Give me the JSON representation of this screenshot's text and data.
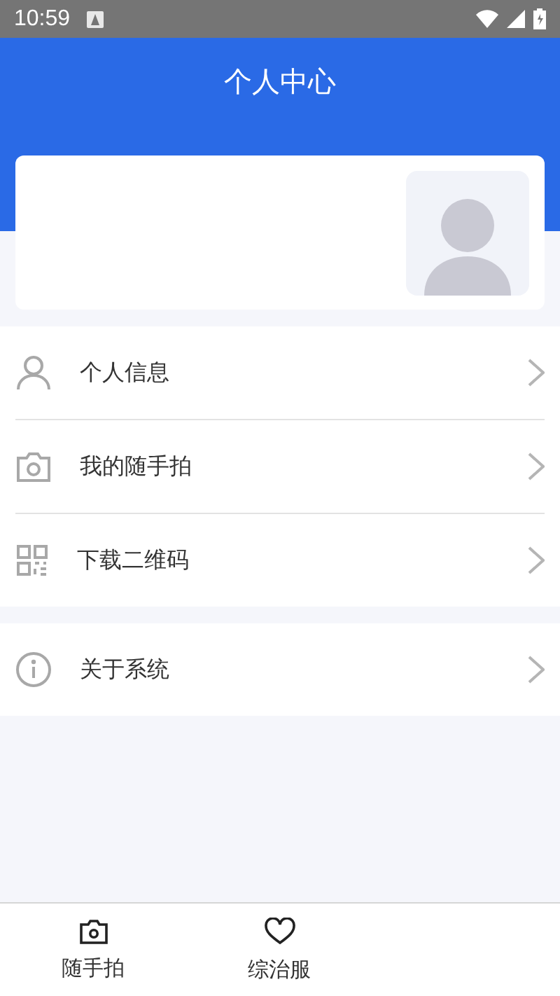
{
  "status_bar": {
    "time": "10:59"
  },
  "header": {
    "title": "个人中心"
  },
  "menu_groups": [
    {
      "items": [
        {
          "label": "个人信息"
        },
        {
          "label": "我的随手拍"
        },
        {
          "label": "下载二维码"
        }
      ]
    },
    {
      "items": [
        {
          "label": "关于系统"
        }
      ]
    }
  ],
  "tab_bar": {
    "tabs": [
      {
        "label": "随手拍"
      },
      {
        "label": "综治服"
      }
    ]
  }
}
